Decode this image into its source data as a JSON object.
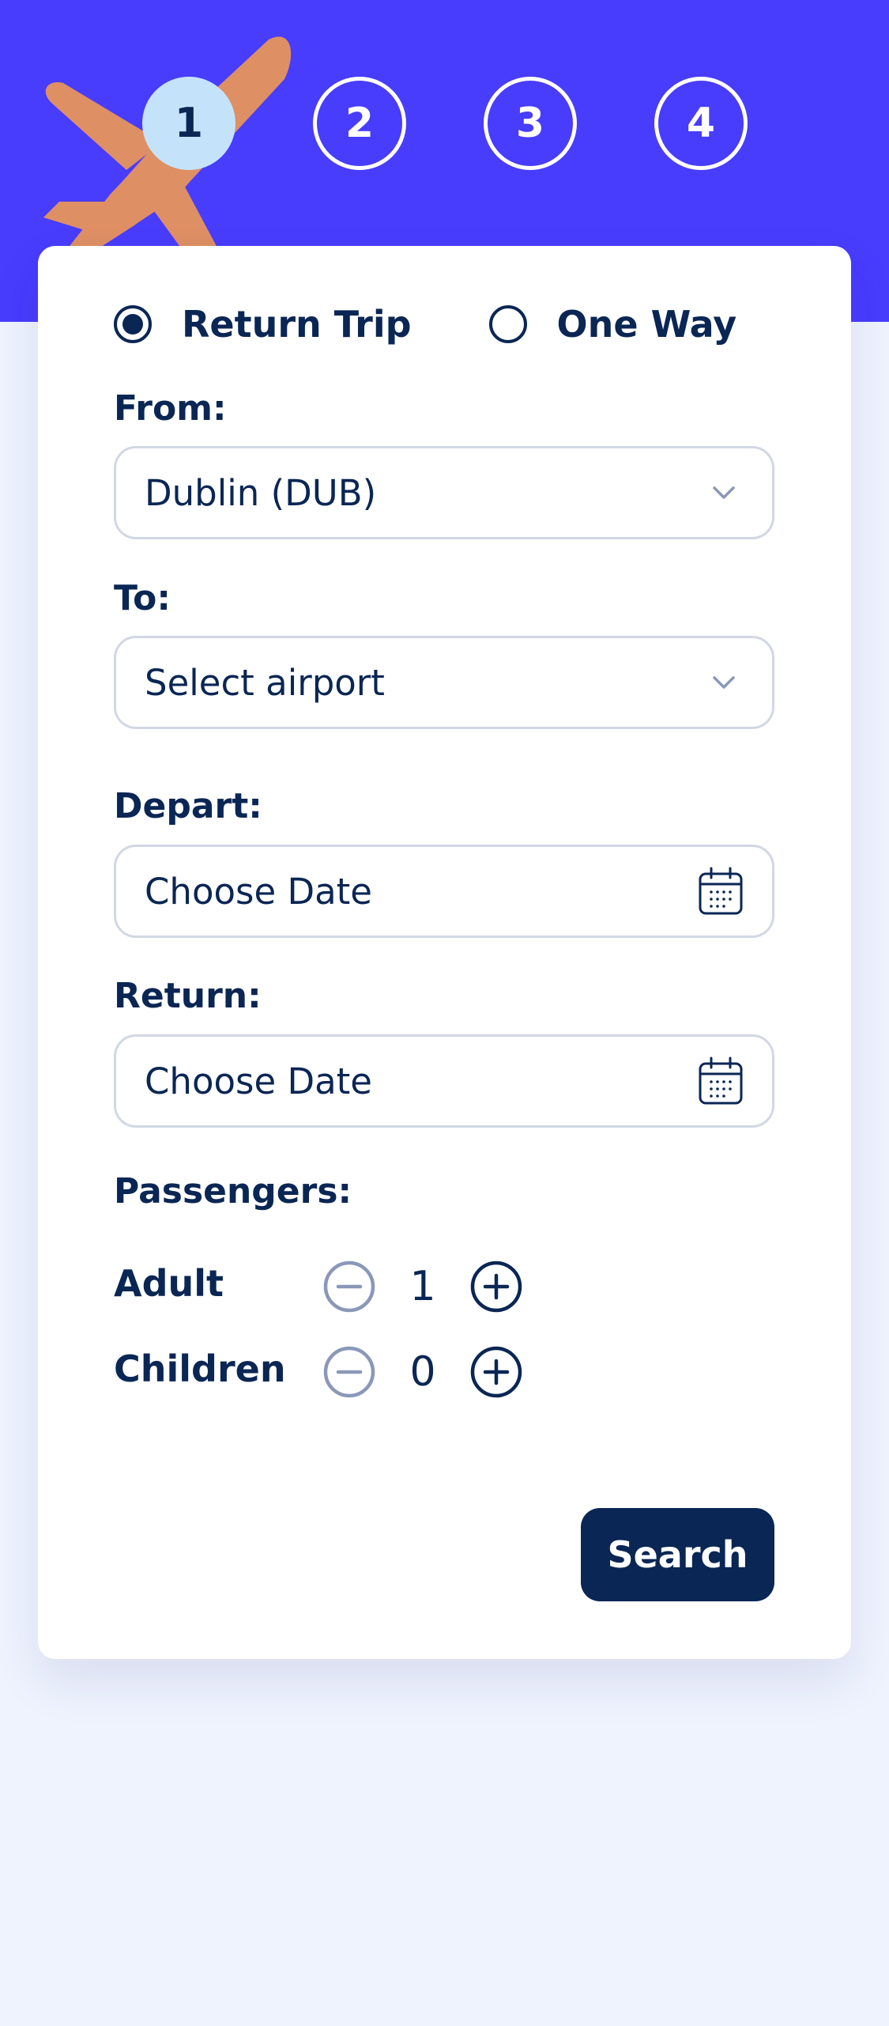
{
  "steps": [
    "1",
    "2",
    "3",
    "4"
  ],
  "active_step": 1,
  "trip_type": {
    "options": [
      "Return Trip",
      "One Way"
    ],
    "selected": "Return Trip"
  },
  "from": {
    "label": "From:",
    "value": "Dublin (DUB)"
  },
  "to": {
    "label": "To:",
    "value": "Select airport"
  },
  "depart": {
    "label": "Depart:",
    "value": "Choose Date"
  },
  "return_date": {
    "label": "Return:",
    "value": "Choose Date"
  },
  "passengers": {
    "label": "Passengers:",
    "rows": [
      {
        "label": "Adult",
        "count": "1"
      },
      {
        "label": "Children",
        "count": "0"
      }
    ]
  },
  "search_label": "Search",
  "colors": {
    "header": "#483CFD",
    "plane": "#DE8F63",
    "active_step": "#C4E3FB",
    "navy": "#0A2654",
    "page_bg": "#EFF3FE"
  }
}
